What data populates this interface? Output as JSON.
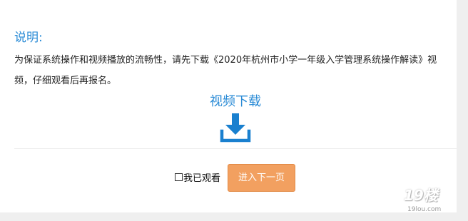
{
  "notice": {
    "title": "说明:",
    "text": "为保证系统操作和视频播放的流畅性，请先下载《2020年杭州市小学一年级入学管理系统操作解读》视频，仔细观看后再报名。"
  },
  "download": {
    "label": "视频下载",
    "icon": "download-icon",
    "color": "#2a8bd6"
  },
  "confirm": {
    "checkbox_checked": false,
    "label": "我已观看"
  },
  "next_button": {
    "label": "进入下一页",
    "color": "#f2a060"
  },
  "watermark": {
    "brand": "19楼",
    "url": "19lou.com"
  }
}
